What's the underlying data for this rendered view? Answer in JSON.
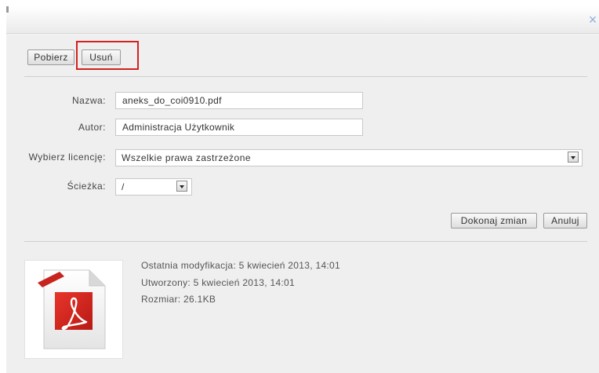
{
  "toolbar": {
    "download_label": "Pobierz",
    "delete_label": "Usuń"
  },
  "form": {
    "name": {
      "label": "Nazwa:",
      "value": "aneks_do_coi0910.pdf"
    },
    "author": {
      "label": "Autor:",
      "value": "Administracja Użytkownik"
    },
    "license": {
      "label": "Wybierz licencję:",
      "value": "Wszelkie prawa zastrzeżone"
    },
    "path": {
      "label": "Ścieżka:",
      "value": "/"
    }
  },
  "actions": {
    "save_label": "Dokonaj zmian",
    "cancel_label": "Anuluj"
  },
  "file_info": {
    "modified": "Ostatnia modyfikacja: 5 kwiecień 2013, 14:01",
    "created": "Utworzony: 5 kwiecień 2013, 14:01",
    "size": "Rozmiar: 26.1KB",
    "icon": "pdf-file-icon"
  },
  "colors": {
    "highlight": "#d42020",
    "pdf_red": "#d8261f",
    "close": "#8fb0d8"
  }
}
